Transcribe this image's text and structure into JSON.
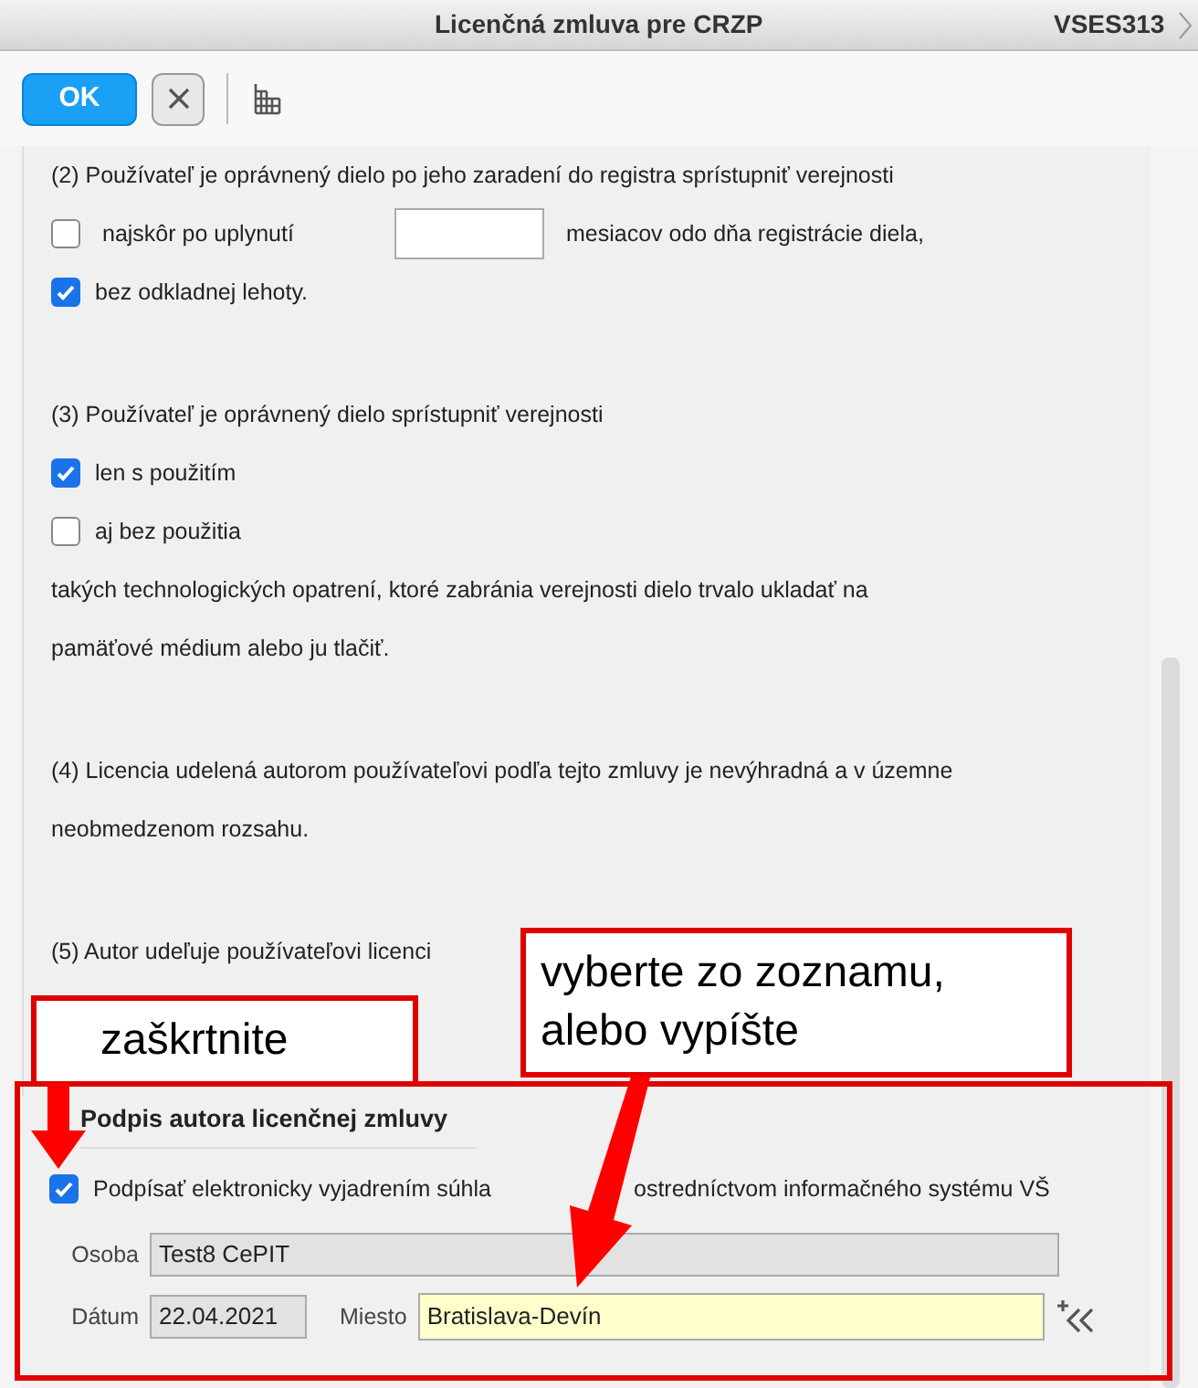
{
  "window": {
    "title": "Licenčná zmluva pre CRZP",
    "code": "VSES313"
  },
  "toolbar": {
    "ok": "OK"
  },
  "paragraphs": [
    {
      "lines": [
        {
          "kind": "text",
          "text": "(2) Používateľ je oprávnený dielo po jeho zaradení do registra sprístupniť verejnosti"
        },
        {
          "kind": "checkbox_input",
          "checked": false,
          "before": "najskôr po uplynutí",
          "after": "mesiacov odo dňa registrácie diela,"
        },
        {
          "kind": "checkbox",
          "checked": true,
          "text": "bez odkladnej lehoty."
        }
      ]
    },
    {
      "lines": [
        {
          "kind": "text",
          "text": "(3) Používateľ je oprávnený dielo sprístupniť verejnosti"
        },
        {
          "kind": "checkbox",
          "checked": true,
          "text": "len s použitím"
        },
        {
          "kind": "checkbox",
          "checked": false,
          "text": "aj bez použitia"
        },
        {
          "kind": "text",
          "text": "takých technologických opatrení, ktoré zabránia verejnosti dielo trvalo ukladať na"
        },
        {
          "kind": "text",
          "text": "pamäťové médium alebo ju tlačiť."
        }
      ]
    },
    {
      "lines": [
        {
          "kind": "text",
          "text": "(4) Licencia udelená autorom používateľovi podľa tejto zmluvy je nevýhradná a v územne"
        },
        {
          "kind": "text",
          "text": "neobmedzenom rozsahu."
        }
      ]
    },
    {
      "lines": [
        {
          "kind": "text",
          "text": "(5) Autor udeľuje používateľovi licenci"
        }
      ]
    }
  ],
  "signature": {
    "title": "Podpis autora licenčnej zmluvy",
    "sign": {
      "checked": true,
      "text_before": "Podpísať elektronicky vyjadrením súhla",
      "text_after": "ostredníctvom informačného systému VŠ"
    },
    "person": {
      "label": "Osoba",
      "value": "Test8 CePIT"
    },
    "date": {
      "label": "Dátum",
      "value": "22.04.2021"
    },
    "place": {
      "label": "Miesto",
      "value": "Bratislava-Devín"
    }
  },
  "annotations": [
    {
      "lines": [
        "zaškrtnite"
      ]
    },
    {
      "lines": [
        "vyberte zo zoznamu,",
        "alebo vypíšte"
      ]
    }
  ]
}
